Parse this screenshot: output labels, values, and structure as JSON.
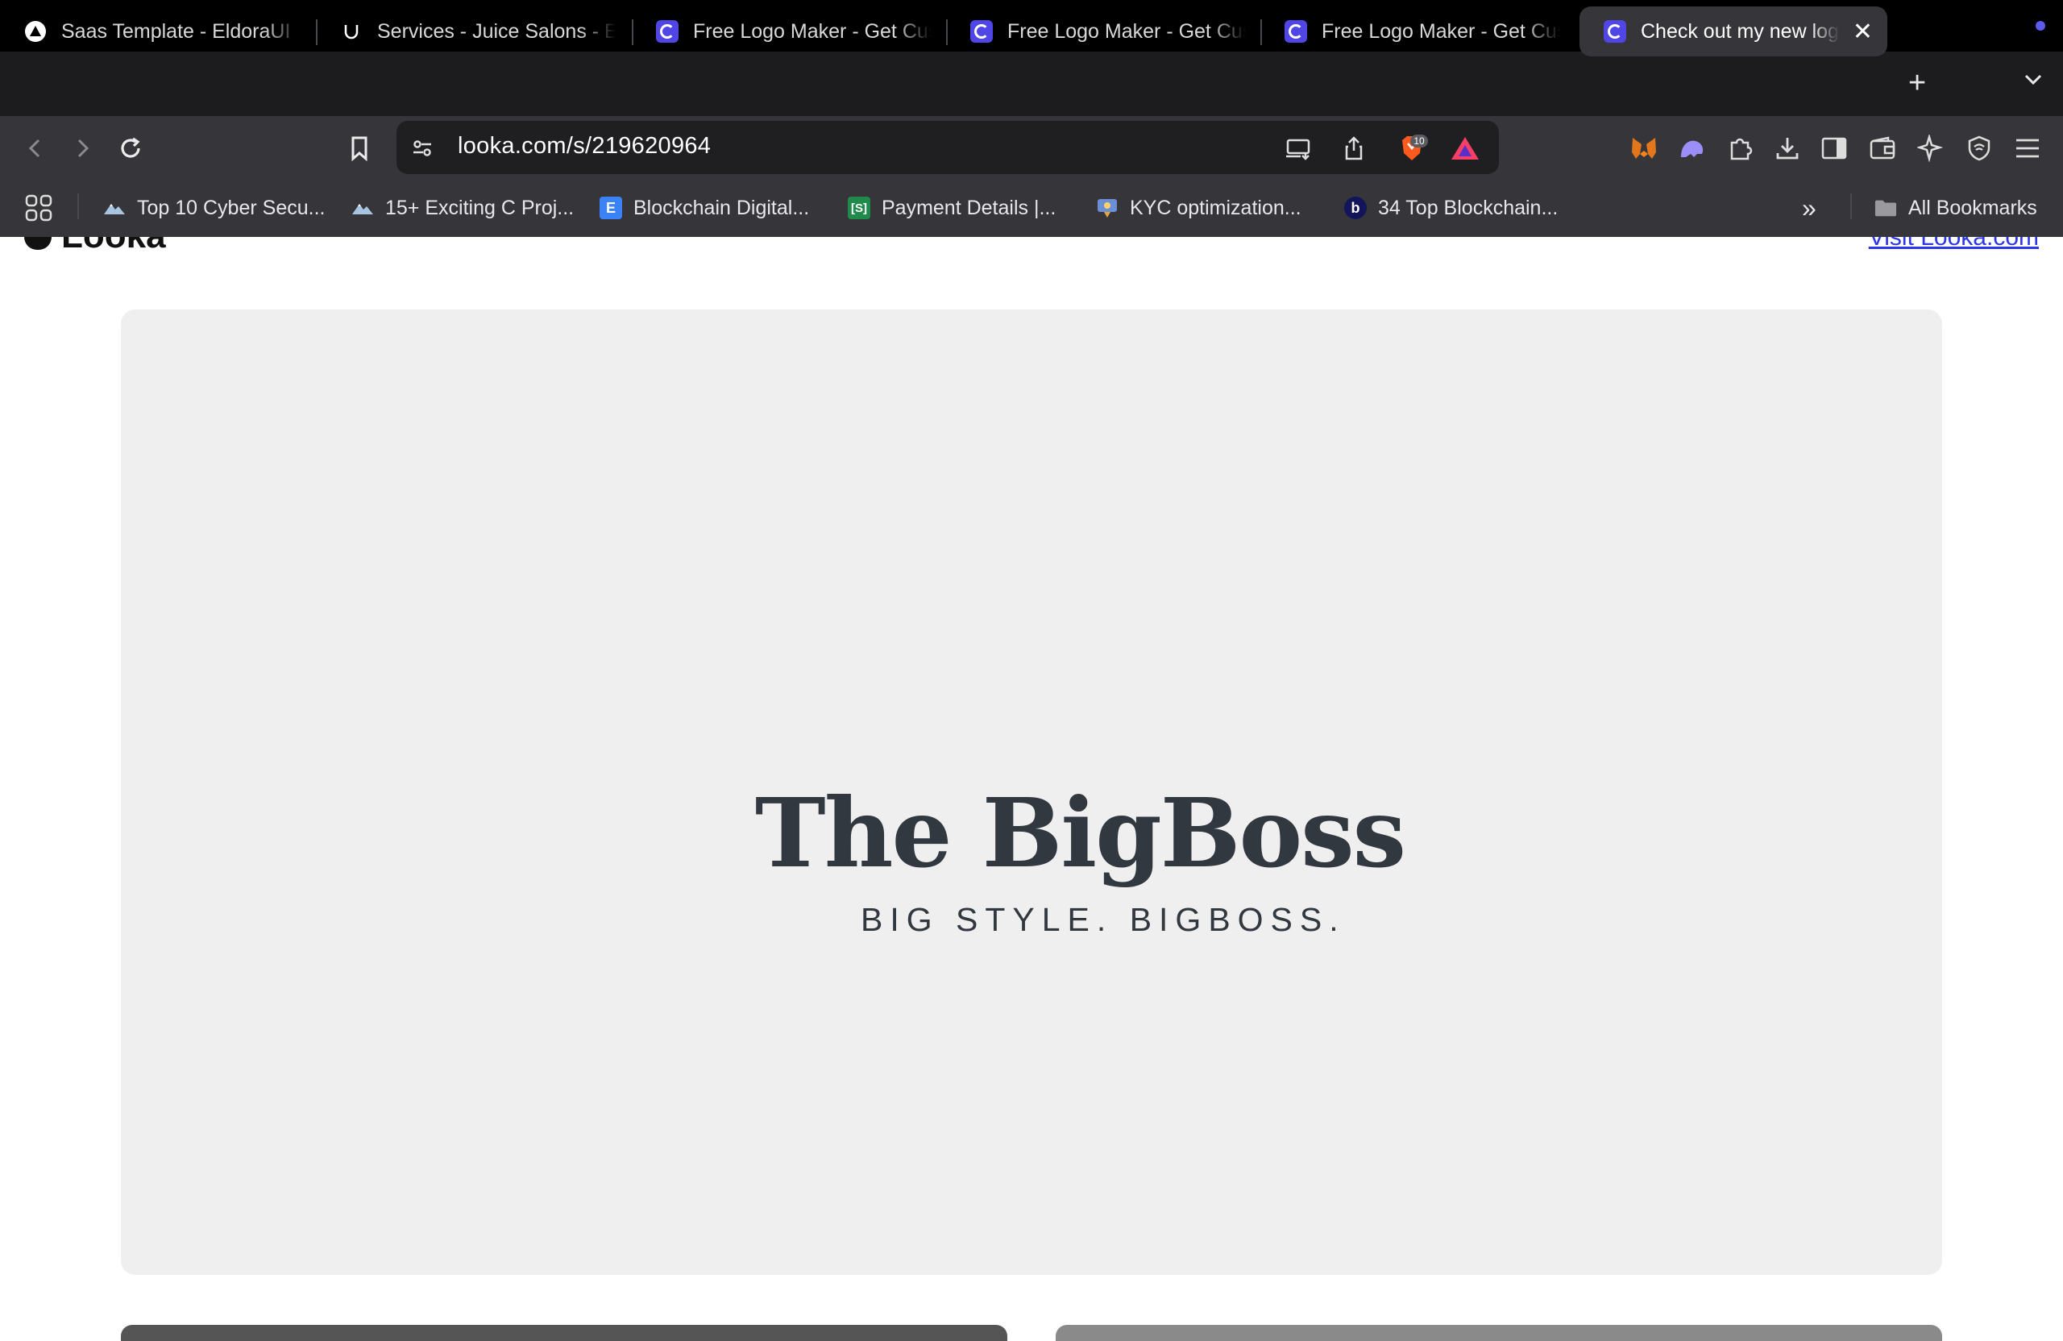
{
  "browser": {
    "tabs": [
      {
        "title": "Saas Template - EldoraUI",
        "favicon": "eldora-triangle-icon"
      },
      {
        "title": "Services - Juice Salons - Elite Hair",
        "favicon": "juice-u-icon"
      },
      {
        "title": "Free Logo Maker - Get Custom Logo",
        "favicon": "looka-icon"
      },
      {
        "title": "Free Logo Maker - Get Custom Logo",
        "favicon": "looka-icon"
      },
      {
        "title": "Free Logo Maker - Get Custom Logo",
        "favicon": "looka-icon"
      },
      {
        "title": "Check out my new logo",
        "favicon": "looka-icon",
        "active": true
      }
    ],
    "close_glyph": "✕",
    "new_tab_glyph": "+",
    "address": {
      "url": "looka.com/s/219620964"
    },
    "shield_badge": "10",
    "bookmarks": [
      {
        "label": "Top 10 Cyber Secu...",
        "icon": "mountain-icon"
      },
      {
        "label": "15+ Exciting C Proj...",
        "icon": "mountain-icon"
      },
      {
        "label": "Blockchain Digital...",
        "icon": "e-icon",
        "glyph": "E"
      },
      {
        "label": "Payment Details |...",
        "icon": "s-icon",
        "glyph": "[S]"
      },
      {
        "label": "KYC optimization...",
        "icon": "kyc-icon"
      },
      {
        "label": "34 Top Blockchain...",
        "icon": "b-icon",
        "glyph": "b"
      }
    ],
    "overflow_glyph": "»",
    "all_bookmarks": "All Bookmarks"
  },
  "page": {
    "site_logo": "Looka",
    "visit_link": "Visit Looka.com",
    "logo_preview": {
      "brand_name": "The BigBoss",
      "tagline": "BIG STYLE. BIGBOSS."
    }
  },
  "colors": {
    "accent": "#4f46e5",
    "hero_bg": "#efefef",
    "logo_text": "#323840",
    "link": "#2e35e6"
  }
}
